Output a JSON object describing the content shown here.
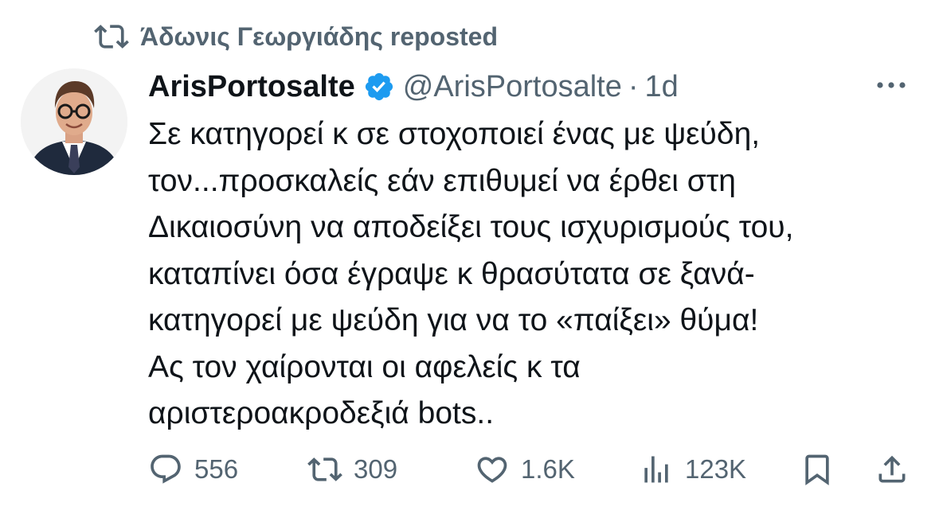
{
  "repost": {
    "label": "Άδωνις Γεωργιάδης reposted",
    "icon": "repost-icon"
  },
  "author": {
    "display_name": "ArisPortosalte",
    "handle": "@ArisPortosalte",
    "separator": "·",
    "time": "1d",
    "verified_color": "#1d9bf0"
  },
  "tweet": {
    "lines": [
      "Σε κατηγορεί κ σε στοχοποιεί ένας με ψεύδη,",
      "τον...προσκαλείς εάν επιθυμεί να έρθει στη",
      "Δικαιοσύνη να αποδείξει τους ισχυρισμούς του,",
      "καταπίνει όσα έγραψε κ θρασύτατα σε ξανά-",
      "κατηγορεί με ψεύδη για να το «παίξει» θύμα!",
      "Ας τον χαίρονται οι αφελείς κ τα",
      "αριστεροακροδεξιά bots.."
    ]
  },
  "actions": {
    "replies": "556",
    "reposts": "309",
    "likes": "1.6K",
    "views": "123K"
  },
  "colors": {
    "text": "#0f1419",
    "secondary": "#536471",
    "accent": "#1d9bf0"
  }
}
